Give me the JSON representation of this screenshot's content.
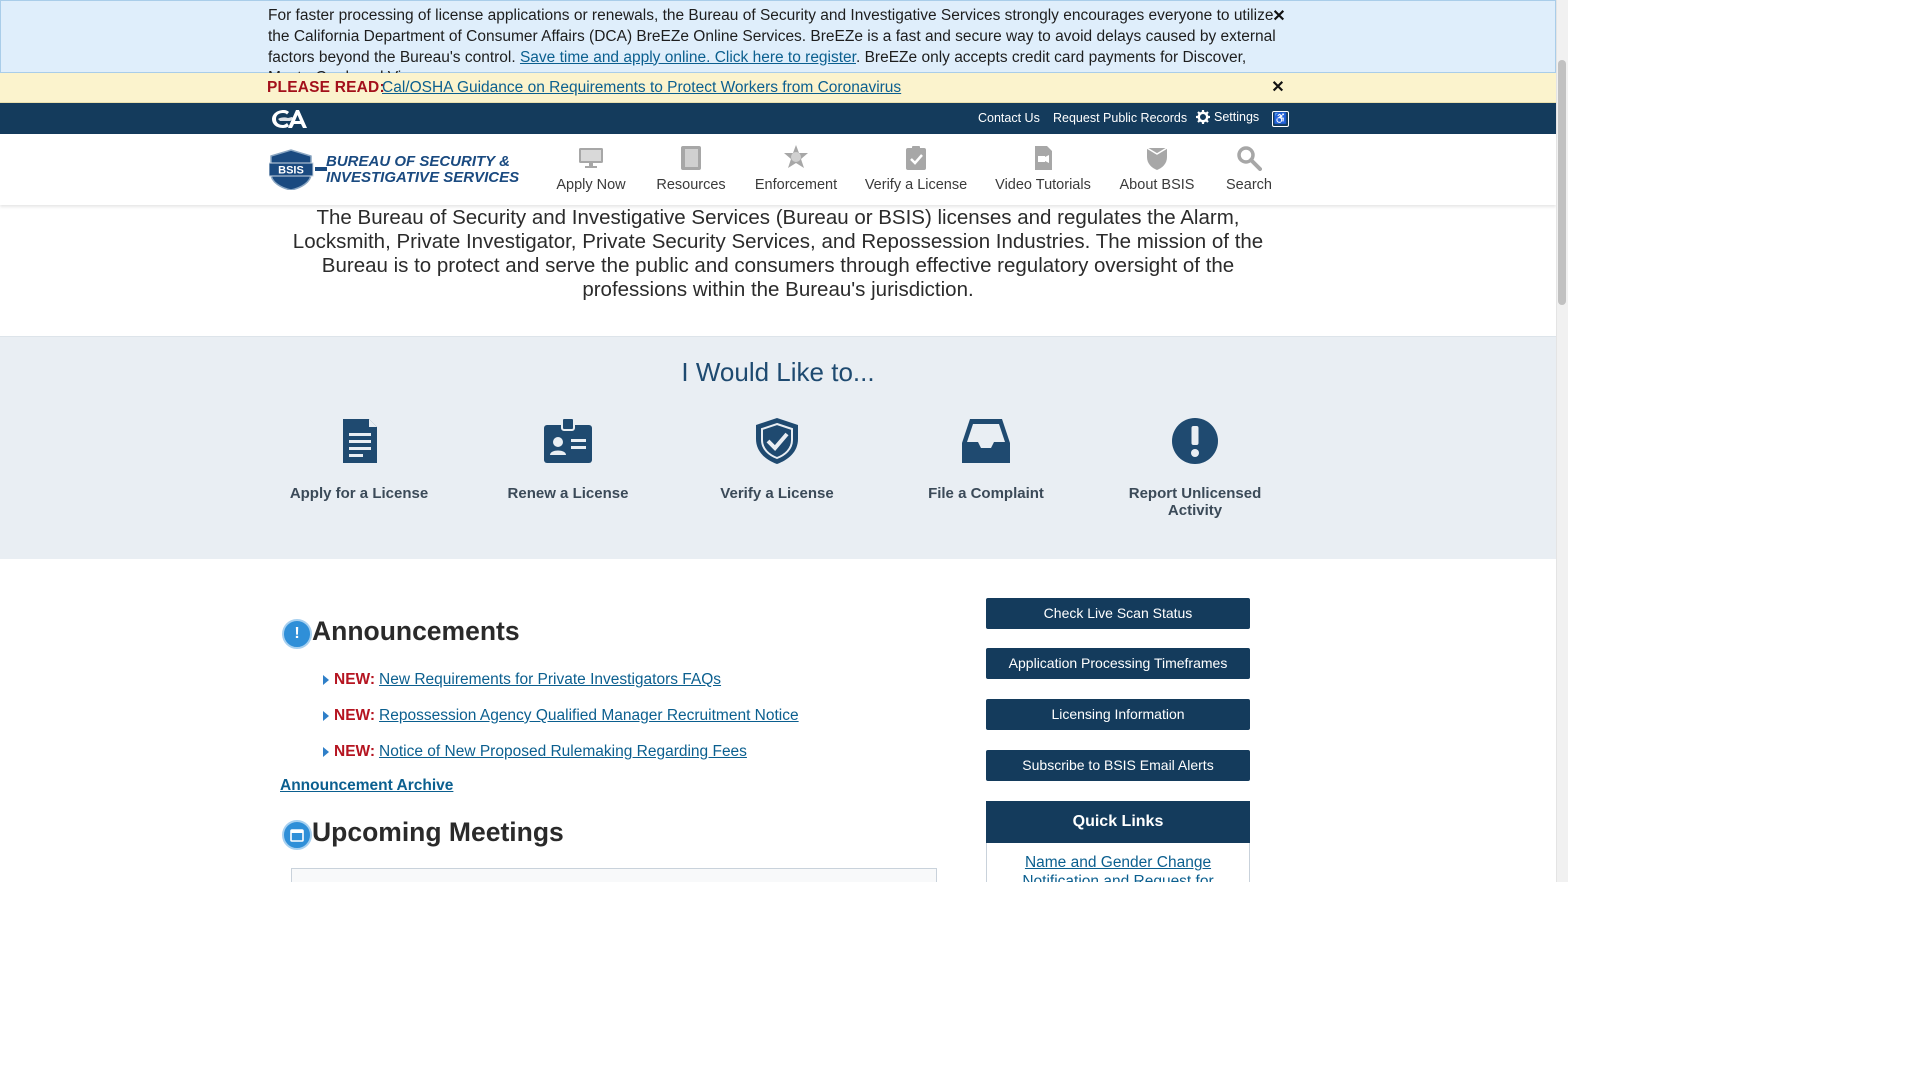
{
  "info_banner": {
    "text_before": "For faster processing of license applications or renewals, the Bureau of Security and Investigative Services strongly encourages everyone to utilize the California Department of Consumer Affairs (DCA) BreEZe Online Services. BreEZe is a fast and secure way to avoid delays caused by external factors beyond the Bureau's control. ",
    "link": "Save time and apply online. Click here to register",
    "text_after": ". BreEZe only accepts credit card payments for Discover, MasterCard, and Visa.",
    "close": "✕"
  },
  "read_banner": {
    "label": "PLEASE READ:",
    "link": "Cal/OSHA Guidance on Requirements to Protect Workers from Coronavirus",
    "close": "✕"
  },
  "utility": {
    "contact": "Contact Us",
    "records": "Request Public Records",
    "settings": "Settings",
    "accessibility_icon": "wheelchair-icon"
  },
  "brand": {
    "line1": "BUREAU OF SECURITY &",
    "line2": "INVESTIGATIVE SERVICES",
    "badge": "BSIS"
  },
  "nav": [
    {
      "label": "Apply Now",
      "icon": "monitor-icon"
    },
    {
      "label": "Resources",
      "icon": "book-icon"
    },
    {
      "label": "Enforcement",
      "icon": "star-badge-icon"
    },
    {
      "label": "Verify a License",
      "icon": "clipboard-check-icon"
    },
    {
      "label": "Video Tutorials",
      "icon": "video-file-icon"
    },
    {
      "label": "About BSIS",
      "icon": "shield-crest-icon"
    },
    {
      "label": "Search",
      "icon": "search-icon"
    }
  ],
  "intro": "The Bureau of Security and Investigative Services (Bureau or BSIS) licenses and regulates the Alarm, Locksmith, Private Investigator, Private Security Services, and Repossession Industries. The mission of the Bureau is to protect and serve the public and consumers through effective regulatory oversight of the professions within the Bureau's jurisdiction.",
  "would_like": {
    "title": "I Would Like to...",
    "items": [
      {
        "label": "Apply for a License",
        "icon": "document-icon"
      },
      {
        "label": "Renew a License",
        "icon": "id-badge-icon"
      },
      {
        "label": "Verify a License",
        "icon": "shield-check-icon"
      },
      {
        "label": "File a Complaint",
        "icon": "inbox-icon"
      },
      {
        "label": "Report Unlicensed Activity",
        "icon": "exclamation-icon"
      }
    ]
  },
  "announcements": {
    "title": "Announcements",
    "items": [
      {
        "tag": "NEW:",
        "link": "New Requirements for Private Investigators FAQs"
      },
      {
        "tag": "NEW:",
        "link": "Repossession Agency Qualified Manager Recruitment Notice"
      },
      {
        "tag": "NEW:",
        "link": "Notice of New Proposed Rulemaking Regarding Fees"
      }
    ],
    "archive": "Announcement Archive"
  },
  "meetings": {
    "title": "Upcoming Meetings"
  },
  "sidebar": {
    "buttons": [
      "Check Live Scan Status",
      "Application Processing Timeframes",
      "Licensing Information",
      "Subscribe to BSIS Email Alerts"
    ],
    "quick_links_title": "Quick Links",
    "quick_link_1": "Name and Gender Change Notification and Request for"
  }
}
